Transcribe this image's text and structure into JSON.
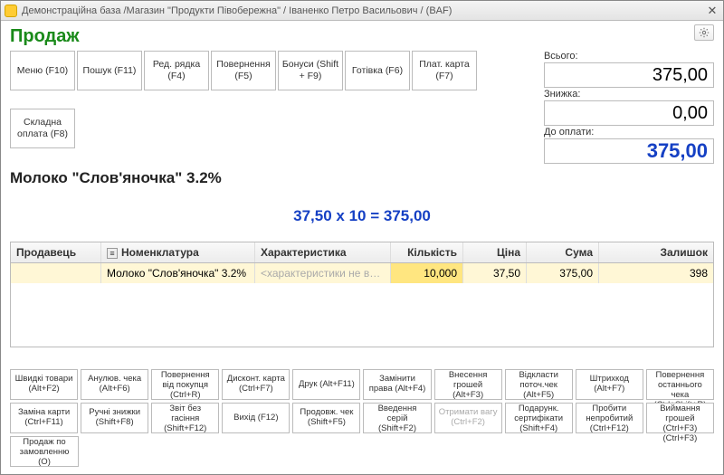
{
  "window": {
    "title": "Демонстраційна база /Магазин \"Продукти Півобережна\" / Іваненко Петро Васильович / (BAF)"
  },
  "heading": "Продаж",
  "toolbar": [
    {
      "label": "Меню (F10)"
    },
    {
      "label": "Пошук (F11)"
    },
    {
      "label": "Ред. рядка (F4)"
    },
    {
      "label": "Повернення (F5)"
    },
    {
      "label": "Бонуси (Shift + F9)"
    },
    {
      "label": "Готівка (F6)"
    },
    {
      "label": "Плат. карта (F7)"
    },
    {
      "label": "Складна оплата (F8)"
    }
  ],
  "totals": {
    "total_label": "Всього:",
    "total_value": "375,00",
    "discount_label": "Знижка:",
    "discount_value": "0,00",
    "due_label": "До оплати:",
    "due_value": "375,00"
  },
  "item_name": "Молоко \"Слов'яночка\" 3.2%",
  "calc_line": "37,50  x 10  = 375,00",
  "grid": {
    "headers": {
      "seller": "Продавець",
      "sku": "Номенклатура",
      "char": "Характеристика",
      "qty": "Кількість",
      "price": "Ціна",
      "sum": "Сума",
      "rem": "Залишок"
    },
    "row": {
      "seller": "",
      "sku": "Молоко \"Слов'яночка\" 3.2%",
      "char": "<характеристики не вик...",
      "qty": "10,000",
      "price": "37,50",
      "sum": "375,00",
      "rem": "398"
    }
  },
  "bottom": {
    "row1": [
      "Швидкі товари (Alt+F2)",
      "Анулюв. чека (Alt+F6)",
      "Повернення від покупця (Ctrl+R)",
      "Дисконт. карта (Ctrl+F7)",
      "Друк (Alt+F11)",
      "Замінити права (Alt+F4)",
      "Внесення грошей (Alt+F3)",
      "Відкласти поточ.чек (Alt+F5)",
      "Штрихкод (Alt+F7)",
      "Повернення останнього чека (Ctrl+Shift+R)"
    ],
    "row2": [
      "Заміна карти (Ctrl+F11)",
      "Ручні знижки (Shift+F8)",
      "Звіт без гасіння (Shift+F12)",
      "Вихід (F12)",
      "Продовж. чек (Shift+F5)",
      "Введення серій (Shift+F2)",
      "Отримати вагу (Ctrl+F2)",
      "Подарунк. сертифікати (Shift+F4)",
      "Пробити непробитий (Ctrl+F12)",
      "Виймання грошей (Ctrl+F3) (Ctrl+F3)"
    ],
    "row3": [
      "Продаж по замовленню (O)"
    ],
    "disabled_index_row2": 6
  }
}
